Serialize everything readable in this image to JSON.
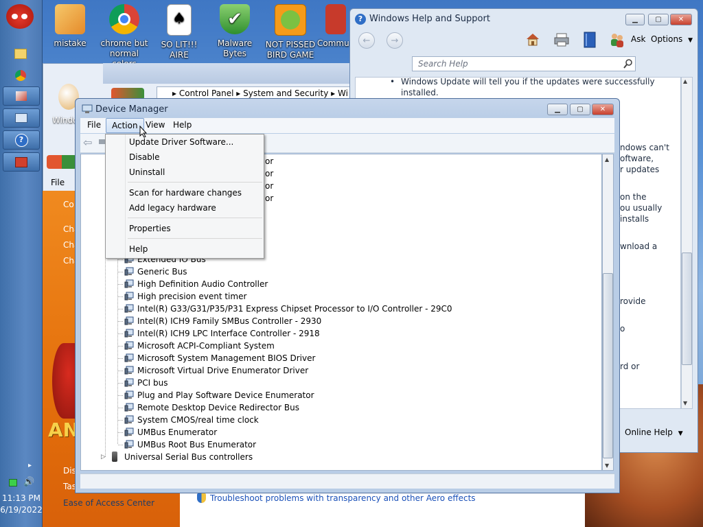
{
  "colors": {
    "window_frame": "#b9cde6",
    "menu_bg": "#f5f6f7",
    "link_blue": "#1a50b8",
    "orange_panel": "#e46f0b",
    "taskbar": "#4c79b4"
  },
  "desktop": {
    "icons": [
      {
        "label": "mistake",
        "icon": "people-icon"
      },
      {
        "label": "chrome but normal colors",
        "icon": "chrome-icon"
      },
      {
        "label": "SO LIT!!! AIRE",
        "icon": "cards-icon"
      },
      {
        "label": "Malware Bytes",
        "icon": "shield-check-icon"
      },
      {
        "label": "NOT PISSED BIRD GAME",
        "icon": "pig-icon"
      },
      {
        "label": "Commu",
        "icon": "community-icon"
      }
    ],
    "partial_icon_label": "Windo Vist"
  },
  "taskbar": {
    "time": "11:13 PM",
    "date": "6/19/2022"
  },
  "background_window": {
    "file_menu": "File",
    "breadcrumb": [
      "Control Panel",
      "System and Security",
      "Wi"
    ],
    "orange_items": [
      "Co",
      "Cha",
      "Cha",
      "Cha"
    ],
    "orange_lower": [
      "Dis",
      "Tas"
    ],
    "ease_link": "Ease of Access Center",
    "troubleshoot_link": "Troubleshoot problems with transparency and other Aero effects"
  },
  "help_window": {
    "title": "Windows Help and Support",
    "search_placeholder": "Search Help",
    "ask": "Ask",
    "options": "Options",
    "bullet_text_line1": "Windows Update will tell you if the updates were successfully",
    "bullet_text_line2": "installed.",
    "partial_lines": [
      "ndows can't",
      "oftware,",
      "r updates",
      "on the",
      "ou usually",
      "installs",
      "wnload a",
      "rovide",
      "o",
      "rd or"
    ],
    "online_help": "Online Help"
  },
  "device_manager": {
    "title": "Device Manager",
    "menu": {
      "file": "File",
      "action": "Action",
      "view": "View",
      "help": "Help"
    },
    "action_menu": {
      "update_driver": "Update Driver Software...",
      "disable": "Disable",
      "uninstall": "Uninstall",
      "scan": "Scan for hardware changes",
      "add_legacy": "Add legacy hardware",
      "properties": "Properties",
      "help": "Help"
    },
    "hidden_row_suffix": "or",
    "devices": [
      "Extended IO Bus",
      "Generic Bus",
      "High Definition Audio Controller",
      "High precision event timer",
      "Intel(R) G33/G31/P35/P31 Express Chipset Processor to I/O Controller - 29C0",
      "Intel(R) ICH9 Family SMBus Controller - 2930",
      "Intel(R) ICH9 LPC Interface Controller - 2918",
      "Microsoft ACPI-Compliant System",
      "Microsoft System Management BIOS Driver",
      "Microsoft Virtual Drive Enumerator Driver",
      "PCI bus",
      "Plug and Play Software Device Enumerator",
      "Remote Desktop Device Redirector Bus",
      "System CMOS/real time clock",
      "UMBus Enumerator",
      "UMBus Root Bus Enumerator"
    ],
    "usb_category": "Universal Serial Bus controllers"
  }
}
